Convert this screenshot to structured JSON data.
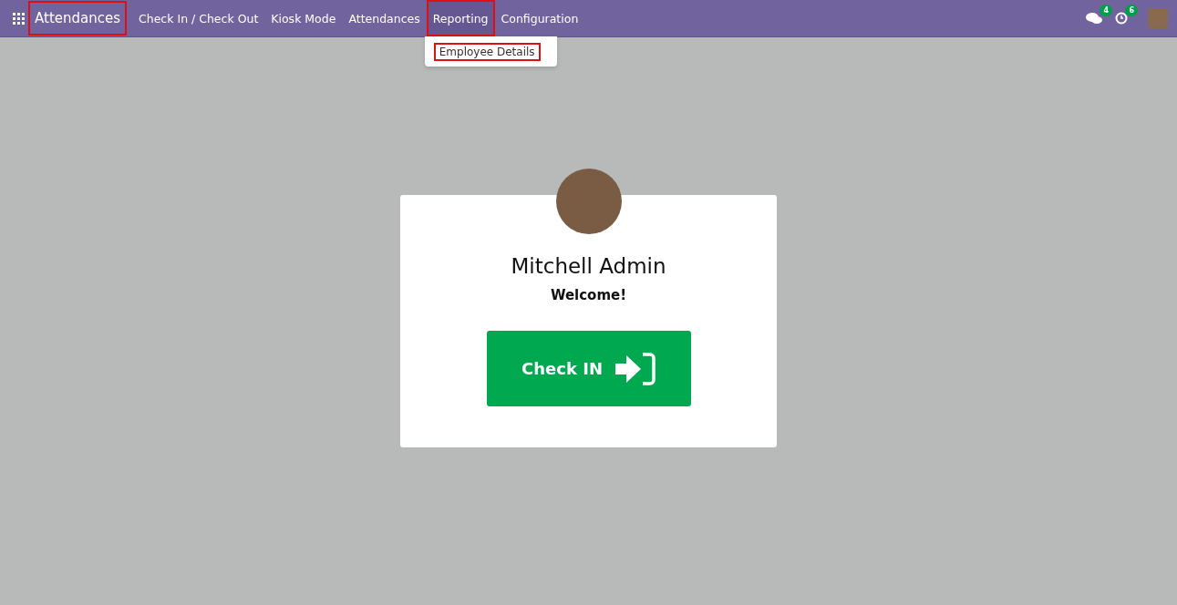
{
  "navbar": {
    "app_title": {
      "label": "Attendances",
      "highlighted": true
    },
    "menu": [
      {
        "label": "Check In / Check Out",
        "selected": false,
        "highlighted": false
      },
      {
        "label": "Kiosk Mode",
        "selected": false,
        "highlighted": false
      },
      {
        "label": "Attendances",
        "selected": false,
        "highlighted": false
      },
      {
        "label": "Reporting",
        "selected": true,
        "highlighted": true
      },
      {
        "label": "Configuration",
        "selected": false,
        "highlighted": false
      }
    ],
    "dropdown": {
      "items": [
        {
          "label": "Employee Details",
          "highlighted": true
        }
      ]
    },
    "messages_badge": "4",
    "activities_badge": "6"
  },
  "card": {
    "name": "Mitchell Admin",
    "greeting": "Welcome!",
    "button": "Check IN"
  }
}
